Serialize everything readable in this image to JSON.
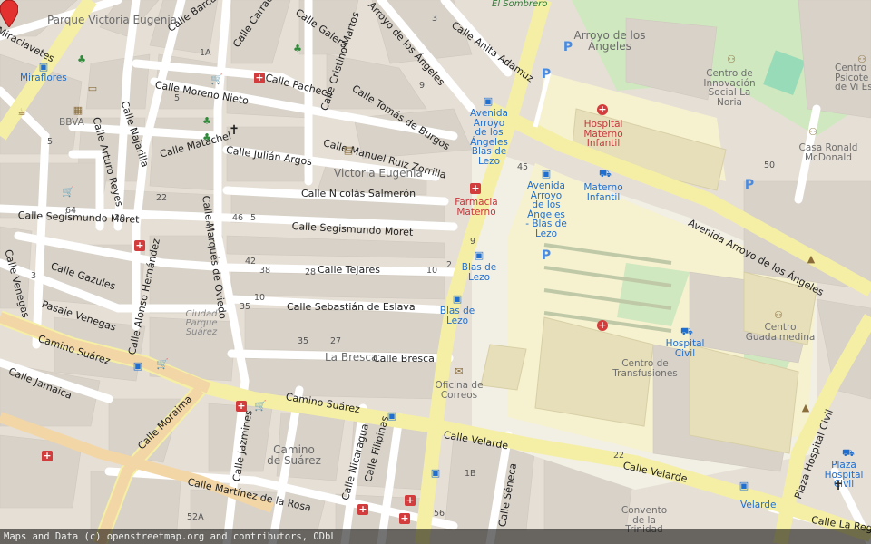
{
  "map": {
    "streets": {
      "calle_moreno_nieto": "Calle Moreno Nieto",
      "calle_pacheco": "Calle Pacheco",
      "calle_matachel": "Calle Matachel",
      "calle_julian_argos": "Calle Julián Argos",
      "calle_nicolas_salmeron": "Calle Nicolás Salmerón",
      "calle_segismundo_moret_w": "Calle Segismundo Moret",
      "calle_segismundo_moret_e": "Calle Segismundo Moret",
      "calle_gazules": "Calle Gazules",
      "calle_tejares": "Calle Tejares",
      "calle_sebastian_de_eslava": "Calle Sebastián de Eslava",
      "pasaje_venegas": "Pasaje Venegas",
      "calle_bresca": "Calle Bresca",
      "camino_suarez_w": "Camino Suárez",
      "camino_suarez_e": "Camino Suárez",
      "calle_jamaica": "Calle Jamaica",
      "calle_moraima": "Calle Moraima",
      "calle_martinez_de_la_rosa": "Calle Martínez de la Rosa",
      "calle_velarde_w": "Calle Velarde",
      "calle_velarde_e": "Calle Velarde",
      "avenida_arroyo_de_los_angeles": "Avenida Arroyo de los Ángeles",
      "arroyo_de_los_angeles": "Arroyo de los Ángeles",
      "calle_barca": "Calle Barca",
      "calle_carraca": "Calle Carraca",
      "calle_galera": "Calle Galera",
      "calle_cristino_martos": "Calle Cristino Martos",
      "calle_tomas_de_burgos": "Calle Tomás de Burgos",
      "calle_manuel_ruiz_zorrilla": "Calle Manuel Ruiz Zorrilla",
      "calle_anita_adamuz": "Calle Anita Adamuz",
      "calle_najarilla": "Calle Najarilla",
      "calle_arturo_reyes": "Calle Arturo Reyes",
      "calle_marques_de_ovieco": "Calle Marqués de Oviedo",
      "calle_venegas": "Calle Venegas",
      "calle_alonso_hernandez": "Calle Alonso Hernández",
      "calle_jazmines": "Calle Jazmines",
      "calle_nicaragua": "Calle Nicaragua",
      "calle_filipinas": "Calle Filipinas",
      "calle_seneca": "Calle Séneca",
      "plaza_hospital_civil_street": "Plaza Hospital Civil",
      "calle_la_rege": "Calle La Rege",
      "miraclavetes": "Miraclavetes"
    },
    "places": {
      "parque_victoria_eugenia": "Parque Victoria Eugenia",
      "victoria_eugenia": "Victoria Eugenia",
      "la_bresca": "La Bresca",
      "ciudad_parque_suarez": "Ciudad Parque Suárez",
      "camino_de_suarez": "Camino de Suárez",
      "arroyo_de_los_angeles_area": "Arroyo de los Ángeles"
    },
    "pois": {
      "miraflores": "Miraflores",
      "bbva": "BBVA",
      "el_sombrero": "El Sombrero",
      "farmacia_materno": "Farmacia Materno",
      "bus_avenida_arroyo_blas_de_lezo": "Avenida Arroyo de los Ángeles Blas de Lezo",
      "bus_avenida_arroyo_blas_de_lezo_2": "Avenida Arroyo de los Ángeles - Blas de Lezo",
      "blas_de_lezo_1": "Blas de Lezo",
      "blas_de_lezo_2": "Blas de Lezo",
      "hospital_materno_infantil": "Hospital Materno Infantil",
      "materno_infantil_bus": "Materno Infantil",
      "centro_innovacion": "Centro de Innovación Social La Noria",
      "casa_ronald": "Casa Ronald McDonald",
      "centro_psicote": "Centro Psicote de Vi Es",
      "oficina_de_correos": "Oficina de Correos",
      "centro_de_transfusiones": "Centro de Transfusiones",
      "hospital_civil": "Hospital Civil",
      "centro_guadalmedina": "Centro Guadalmedina",
      "plaza_hospital_civil": "Plaza Hospital Civil",
      "velarde_bus": "Velarde",
      "convento_de_la_trinidad": "Convento de la Trinidad"
    },
    "house_numbers": [
      "1A",
      "5",
      "32",
      "30",
      "16",
      "6",
      "4",
      "3",
      "13",
      "1",
      "22",
      "17",
      "19",
      "4",
      "5",
      "9",
      "8",
      "25",
      "10",
      "33",
      "20",
      "2",
      "46",
      "64",
      "52",
      "3",
      "5",
      "7",
      "28",
      "54",
      "42",
      "40",
      "17",
      "6",
      "2",
      "3",
      "5",
      "12",
      "61",
      "27",
      "46",
      "42",
      "38",
      "34",
      "30",
      "26",
      "21",
      "17",
      "28",
      "22",
      "10",
      "6",
      "4",
      "14",
      "8",
      "35",
      "30",
      "9",
      "10",
      "7",
      "5",
      "3",
      "2",
      "35",
      "27",
      "18",
      "44",
      "10",
      "5",
      "4",
      "43",
      "35",
      "1A",
      "41",
      "33",
      "41",
      "25",
      "21",
      "19",
      "18",
      "40",
      "50",
      "45",
      "22",
      "1B",
      "56",
      "52A",
      "25",
      "2"
    ],
    "marker_color": "#e3312f"
  },
  "attribution": "Maps and Data (c) openstreetmap.org and contributors, ODbL"
}
